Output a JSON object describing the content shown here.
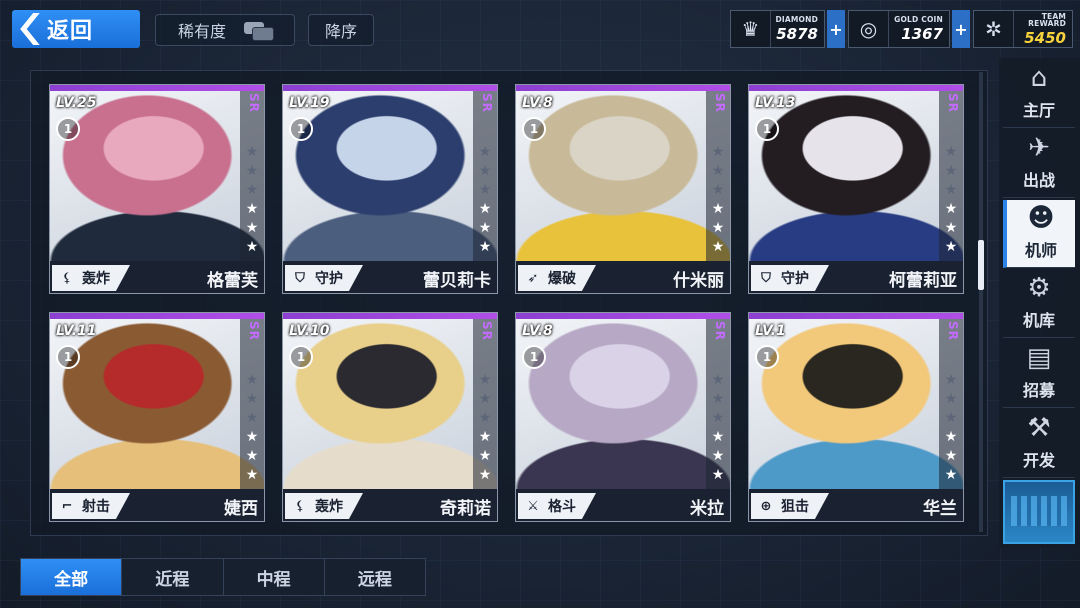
{
  "header": {
    "back_label": "返回",
    "sort_label": "稀有度",
    "order_label": "降序"
  },
  "currencies": [
    {
      "caption": "DIAMOND",
      "value": "5878",
      "icon": "diamond-icon",
      "color": "#ffffff"
    },
    {
      "caption": "GOLD COIN",
      "value": "1367",
      "icon": "gold-coin-icon",
      "color": "#ffffff"
    },
    {
      "caption": "TEAM REWARD",
      "value": "5450",
      "icon": "team-reward-icon",
      "color": "#f6d23c"
    }
  ],
  "cards": [
    {
      "level": "LV.25",
      "rank": "1",
      "rarity": "SR",
      "stars_on": 3,
      "stars_total": 6,
      "role": "轰炸",
      "role_icon": "mortar-icon",
      "name": "格蕾芙",
      "palette": [
        "#c9708f",
        "#1f2b3d",
        "#e8a8bd"
      ]
    },
    {
      "level": "LV.19",
      "rank": "1",
      "rarity": "SR",
      "stars_on": 3,
      "stars_total": 6,
      "role": "守护",
      "role_icon": "shield-icon",
      "name": "蕾贝莉卡",
      "palette": [
        "#2c3e6e",
        "#4c5e7e",
        "#c6d4ea"
      ]
    },
    {
      "level": "LV.8",
      "rank": "1",
      "rarity": "SR",
      "stars_on": 3,
      "stars_total": 6,
      "role": "爆破",
      "role_icon": "rocket-icon",
      "name": "什米丽",
      "palette": [
        "#c8b998",
        "#e8c23a",
        "#d9d4c5"
      ]
    },
    {
      "level": "LV.13",
      "rank": "1",
      "rarity": "SR",
      "stars_on": 3,
      "stars_total": 6,
      "role": "守护",
      "role_icon": "shield-icon",
      "name": "柯蕾莉亚",
      "palette": [
        "#231d22",
        "#283c84",
        "#e6e3ea"
      ]
    },
    {
      "level": "LV.11",
      "rank": "1",
      "rarity": "SR",
      "stars_on": 3,
      "stars_total": 6,
      "role": "射击",
      "role_icon": "rifle-icon",
      "name": "婕西",
      "palette": [
        "#8a5a33",
        "#e6c07a",
        "#b52b2b"
      ]
    },
    {
      "level": "LV.10",
      "rank": "1",
      "rarity": "SR",
      "stars_on": 3,
      "stars_total": 6,
      "role": "轰炸",
      "role_icon": "mortar-icon",
      "name": "奇莉诺",
      "palette": [
        "#e8cf8a",
        "#e6dccb",
        "#2a2a30"
      ]
    },
    {
      "level": "LV.8",
      "rank": "1",
      "rarity": "SR",
      "stars_on": 3,
      "stars_total": 6,
      "role": "格斗",
      "role_icon": "crossed-swords-icon",
      "name": "米拉",
      "palette": [
        "#b7a9c6",
        "#3a3550",
        "#dad3e8"
      ]
    },
    {
      "level": "LV.1",
      "rank": "1",
      "rarity": "SR",
      "stars_on": 3,
      "stars_total": 6,
      "role": "狙击",
      "role_icon": "sniper-icon",
      "name": "华兰",
      "palette": [
        "#f2c87a",
        "#4d9ac9",
        "#2a2620"
      ]
    }
  ],
  "nav": {
    "items": [
      {
        "label": "主厅",
        "icon": "hall-icon",
        "active": false
      },
      {
        "label": "出战",
        "icon": "sortie-icon",
        "active": false
      },
      {
        "label": "机师",
        "icon": "pilot-icon",
        "active": true
      },
      {
        "label": "机库",
        "icon": "hangar-icon",
        "active": false
      },
      {
        "label": "招募",
        "icon": "recruit-icon",
        "active": false
      },
      {
        "label": "开发",
        "icon": "develop-icon",
        "active": false
      }
    ]
  },
  "tabs": [
    {
      "label": "全部",
      "active": true
    },
    {
      "label": "近程",
      "active": false
    },
    {
      "label": "中程",
      "active": false
    },
    {
      "label": "远程",
      "active": false
    }
  ]
}
